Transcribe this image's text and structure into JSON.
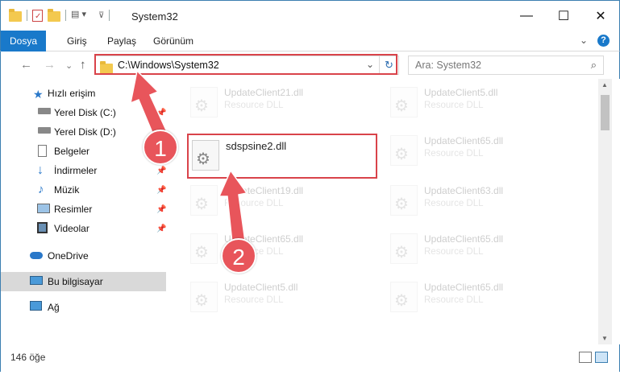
{
  "window": {
    "title": "System32",
    "controls": {
      "minimize": "—",
      "maximize": "☐",
      "close": "✕"
    }
  },
  "ribbon": {
    "tabs": [
      "Dosya",
      "Giriş",
      "Paylaş",
      "Görünüm"
    ],
    "expand": "⌄",
    "help": "?"
  },
  "nav": {
    "back": "←",
    "forward": "→",
    "recent": "⌄",
    "up": "↑",
    "address": "C:\\Windows\\System32",
    "address_dropdown": "⌄",
    "refresh": "↻",
    "search_placeholder": "Ara: System32",
    "search_icon": "⌕"
  },
  "sidebar": {
    "items": [
      {
        "label": "Hızlı erişim",
        "icon": "star-icon",
        "pinned": false
      },
      {
        "label": "Yerel Disk (C:)",
        "icon": "drive-icon",
        "pinned": true
      },
      {
        "label": "Yerel Disk (D:)",
        "icon": "drive-icon",
        "pinned": true
      },
      {
        "label": "Belgeler",
        "icon": "documents-icon",
        "pinned": true
      },
      {
        "label": "İndirmeler",
        "icon": "download-icon",
        "pinned": true
      },
      {
        "label": "Müzik",
        "icon": "music-icon",
        "pinned": true
      },
      {
        "label": "Resimler",
        "icon": "pictures-icon",
        "pinned": true
      },
      {
        "label": "Videolar",
        "icon": "videos-icon",
        "pinned": true
      },
      {
        "label": "OneDrive",
        "icon": "cloud-icon",
        "pinned": false
      },
      {
        "label": "Bu bilgisayar",
        "icon": "computer-icon",
        "pinned": false
      },
      {
        "label": "Ağ",
        "icon": "network-icon",
        "pinned": false
      }
    ],
    "pin_glyph": "📌"
  },
  "files": {
    "ghost": [
      {
        "name": "UpdateClient21.dll",
        "type": "Resource DLL"
      },
      {
        "name": "UpdateClient5.dll",
        "type": "Resource DLL"
      },
      {
        "name": "UpdateClient65.dll",
        "type": "Resource DLL"
      },
      {
        "name": "UpdateClient19.dll",
        "type": "Resource DLL"
      },
      {
        "name": "UpdateClient63.dll",
        "type": "Resource DLL"
      },
      {
        "name": "UpdateClient65.dll",
        "type": "Resource DLL"
      },
      {
        "name": "UpdateClient65.dll",
        "type": "Resource DLL"
      },
      {
        "name": "UpdateClient5.dll",
        "type": "Resource DLL"
      },
      {
        "name": "UpdateClient65.dll",
        "type": "Resource DLL"
      }
    ],
    "highlighted": {
      "name": "sdspsine2.dll"
    }
  },
  "status": {
    "count": "146 öğe"
  },
  "callouts": [
    "1",
    "2"
  ],
  "colors": {
    "accent": "#1979ca",
    "highlight": "#d9434a",
    "arrow": "#e8555b"
  }
}
